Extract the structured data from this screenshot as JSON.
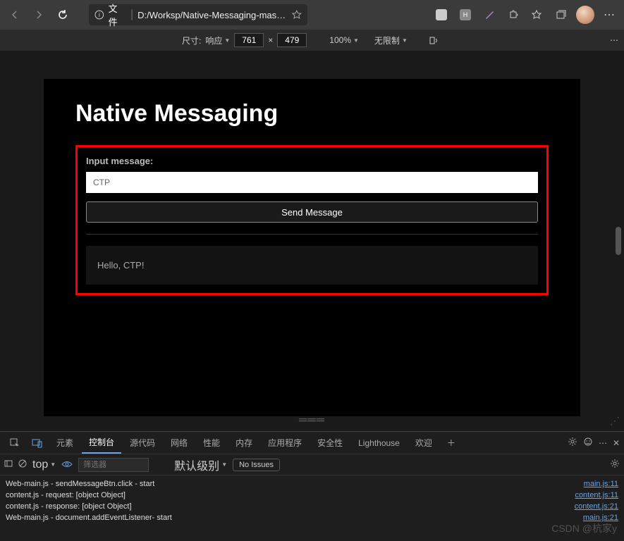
{
  "browser": {
    "file_label": "文件",
    "url": "D:/Worksp/Native-Messaging-maste...",
    "ext_h": "H"
  },
  "responsive": {
    "size_label": "尺寸:",
    "mode": "响应",
    "width": "761",
    "height": "479",
    "zoom": "100%",
    "throttle": "无限制"
  },
  "page": {
    "title": "Native Messaging",
    "input_label": "Input message:",
    "input_value": "CTP",
    "send_label": "Send Message",
    "output": "Hello, CTP!"
  },
  "devtools": {
    "tabs": {
      "elements": "元素",
      "console": "控制台",
      "sources": "源代码",
      "network": "网络",
      "performance": "性能",
      "memory": "内存",
      "application": "应用程序",
      "security": "安全性",
      "lighthouse": "Lighthouse",
      "welcome": "欢迎"
    },
    "filter": {
      "context": "top",
      "placeholder": "筛选器",
      "level": "默认级别",
      "issues": "No Issues"
    },
    "logs": [
      {
        "msg": "Web-main.js - sendMessageBtn.click - start",
        "src": "main.js:11"
      },
      {
        "msg": "content.js - request: [object Object]",
        "src": "content.js:11"
      },
      {
        "msg": "content.js - response: [object Object]",
        "src": "content.js:21"
      },
      {
        "msg": "Web-main.js - document.addEventListener- start",
        "src": "main.js:21"
      }
    ]
  },
  "watermark": "CSDN @杭家y"
}
